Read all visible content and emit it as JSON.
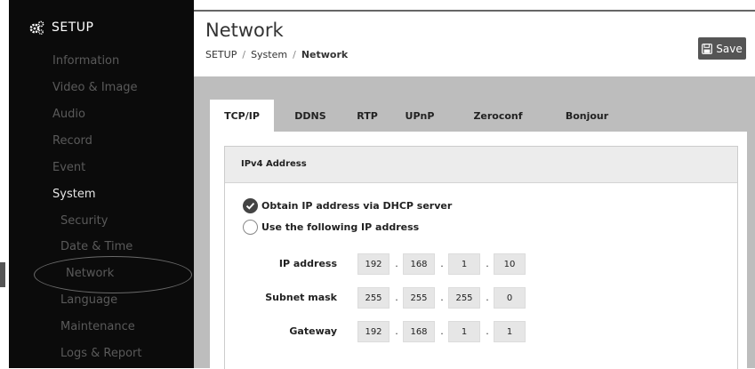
{
  "sidebar": {
    "header": "SETUP",
    "items": [
      {
        "label": "Information"
      },
      {
        "label": "Video & Image"
      },
      {
        "label": "Audio"
      },
      {
        "label": "Record"
      },
      {
        "label": "Event"
      },
      {
        "label": "System"
      },
      {
        "label": "Security"
      },
      {
        "label": "Date & Time"
      },
      {
        "label": "Network"
      },
      {
        "label": "Language"
      },
      {
        "label": "Maintenance"
      },
      {
        "label": "Logs & Report"
      }
    ]
  },
  "header": {
    "title": "Network",
    "breadcrumb": [
      "SETUP",
      "System",
      "Network"
    ],
    "breadcrumb_sep": "/",
    "save_label": "Save"
  },
  "tabs": [
    {
      "label": "TCP/IP"
    },
    {
      "label": "DDNS"
    },
    {
      "label": "RTP"
    },
    {
      "label": "UPnP"
    },
    {
      "label": "Zeroconf"
    },
    {
      "label": "Bonjour"
    }
  ],
  "panel": {
    "title": "IPv4 Address",
    "options": [
      {
        "label": "Obtain IP address via DHCP server",
        "checked": true
      },
      {
        "label": "Use the following IP address",
        "checked": false
      }
    ],
    "fields": [
      {
        "label": "IP address",
        "octets": [
          "192",
          "168",
          "1",
          "10"
        ]
      },
      {
        "label": "Subnet mask",
        "octets": [
          "255",
          "255",
          "255",
          "0"
        ]
      },
      {
        "label": "Gateway",
        "octets": [
          "192",
          "168",
          "1",
          "1"
        ]
      }
    ],
    "octet_sep": "."
  },
  "colors": {
    "sidebar_bg": "#0b0b0b",
    "content_bg": "#bdbdbd",
    "save_button": "#555555"
  },
  "icons": {
    "setup": "gears-icon",
    "save": "floppy-disk-icon",
    "radio_checked": "checkmark-icon"
  }
}
